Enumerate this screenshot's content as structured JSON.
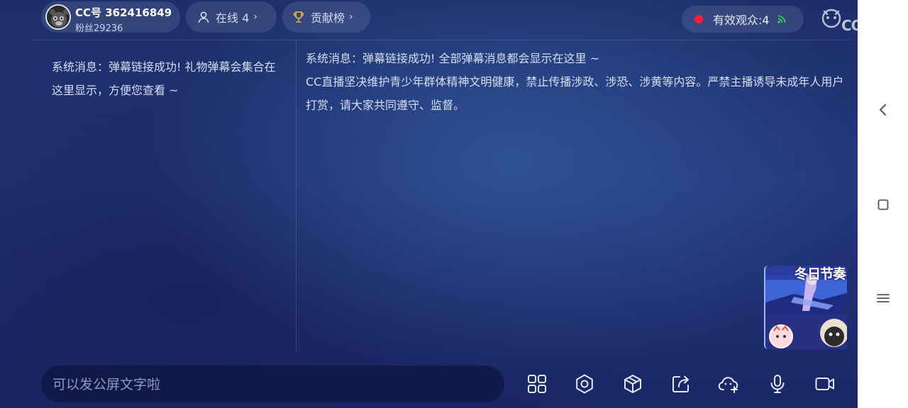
{
  "header": {
    "anchor": {
      "name": "CC号 362416849",
      "fans": "粉丝29236"
    },
    "online": {
      "label": "在线 4"
    },
    "contribution": {
      "label": "贡献榜"
    },
    "viewers": {
      "label": "有效观众:4"
    },
    "logo_text": "CC直播"
  },
  "messages": {
    "left": "系统消息：弹幕链接成功! 礼物弹幕会集合在这里显示，方便您查看 ~",
    "right": [
      "系统消息：弹幕链接成功! 全部弹幕消息都会显示在这里 ~",
      "CC直播坚决维护青少年群体精神文明健康，禁止传播涉政、涉恐、涉黄等内容。严禁主播诱导未成年人用户打赏，请大家共同遵守、监督。"
    ]
  },
  "thumbnail": {
    "title": "冬日节奏"
  },
  "bottom": {
    "input_placeholder": "可以发公屏文字啦"
  },
  "colors": {
    "accent_live": "#ff1f3a",
    "signal": "#3ddc4a",
    "trophy": "#f4b93a"
  },
  "icons": {
    "bottom_tools": [
      "grid-icon",
      "settings-icon",
      "cube-icon",
      "share-icon",
      "cloud-add-icon",
      "microphone-icon",
      "video-camera-icon"
    ],
    "nav": [
      "back-icon",
      "home-icon",
      "menu-icon"
    ]
  }
}
